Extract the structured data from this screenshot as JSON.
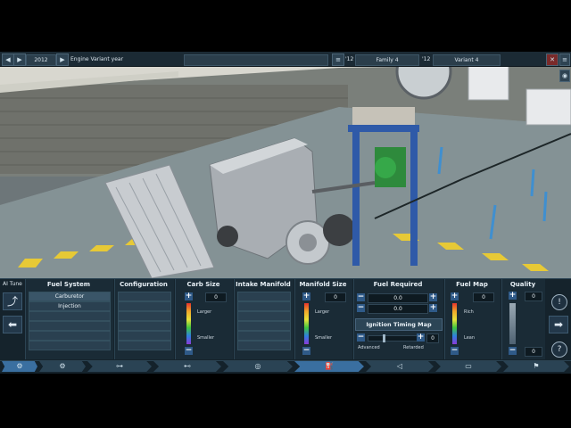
{
  "topbar": {
    "prev_label": "◀",
    "play_label": "▶",
    "year_value": "2012",
    "next_label": "▶",
    "variant_year_label": "Engine Variant year",
    "family_year_value": "'12",
    "family_name_value": "Family 4",
    "variant_year_value": "'12",
    "variant_name_value": "Variant 4"
  },
  "left_panel": {
    "ai_tune_label": "AI Tune"
  },
  "fuel_system": {
    "header": "Fuel System",
    "options": [
      "Carburetor",
      "Injection"
    ]
  },
  "configuration": {
    "header": "Configuration"
  },
  "carb_size": {
    "header": "Carb Size",
    "value": "0",
    "larger_label": "Larger",
    "smaller_label": "Smaller"
  },
  "intake_manifold": {
    "header": "Intake Manifold"
  },
  "manifold_size": {
    "header": "Manifold Size",
    "value": "0",
    "larger_label": "Larger",
    "smaller_label": "Smaller"
  },
  "fuel_required": {
    "header": "Fuel Required",
    "value1": "0.0",
    "value2": "0.0"
  },
  "ignition_timing": {
    "header": "Ignition Timing Map",
    "value": "0",
    "advanced_label": "Advanced",
    "retarded_label": "Retarded"
  },
  "fuel_map": {
    "header": "Fuel Map",
    "value": "0",
    "rich_label": "Rich",
    "lean_label": "Lean"
  },
  "quality": {
    "header": "Quality",
    "value_top": "0",
    "value_bottom": "0"
  },
  "icons": {
    "help": "?",
    "info": "!",
    "next_arrow": "➡",
    "prev_arrow": "⬅"
  }
}
